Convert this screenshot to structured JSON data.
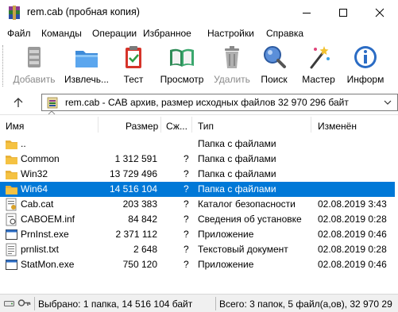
{
  "window": {
    "title": "rem.cab (пробная копия)"
  },
  "menu": [
    "Файл",
    "Команды",
    "Операции",
    "Избранное",
    "Настройки",
    "Справка"
  ],
  "toolbar": {
    "add": "Добавить",
    "extract": "Извлечь...",
    "test": "Тест",
    "view": "Просмотр",
    "delete": "Удалить",
    "find": "Поиск",
    "wizard": "Мастер",
    "info": "Информ"
  },
  "path": {
    "text": "rem.cab - CAB архив, размер исходных файлов 32 970 296 байт"
  },
  "columns": {
    "name": "Имя",
    "size": "Размер",
    "packed": "Сж...",
    "type": "Тип",
    "modified": "Изменён"
  },
  "rows": [
    {
      "name": "..",
      "size": "",
      "packed": "",
      "type": "Папка с файлами",
      "modified": "",
      "icon": "folder-up-icon"
    },
    {
      "name": "Common",
      "size": "1 312 591",
      "packed": "?",
      "type": "Папка с файлами",
      "modified": "",
      "icon": "folder-icon"
    },
    {
      "name": "Win32",
      "size": "13 729 496",
      "packed": "?",
      "type": "Папка с файлами",
      "modified": "",
      "icon": "folder-icon"
    },
    {
      "name": "Win64",
      "size": "14 516 104",
      "packed": "?",
      "type": "Папка с файлами",
      "modified": "",
      "icon": "folder-icon"
    },
    {
      "name": "Cab.cat",
      "size": "203 383",
      "packed": "?",
      "type": "Каталог безопасности",
      "modified": "02.08.2019 3:43",
      "icon": "catalog-icon"
    },
    {
      "name": "CABOEM.inf",
      "size": "84 842",
      "packed": "?",
      "type": "Сведения об установке",
      "modified": "02.08.2019 0:28",
      "icon": "inf-file-icon"
    },
    {
      "name": "PrnInst.exe",
      "size": "2 371 112",
      "packed": "?",
      "type": "Приложение",
      "modified": "02.08.2019 0:46",
      "icon": "exe-icon"
    },
    {
      "name": "prnlist.txt",
      "size": "2 648",
      "packed": "?",
      "type": "Текстовый документ",
      "modified": "02.08.2019 0:28",
      "icon": "text-file-icon"
    },
    {
      "name": "StatMon.exe",
      "size": "750 120",
      "packed": "?",
      "type": "Приложение",
      "modified": "02.08.2019 0:46",
      "icon": "exe-icon"
    }
  ],
  "selected_row_index": 3,
  "status": {
    "left": "Выбрано: 1 папка, 14 516 104 байт",
    "right": "Всего: 3 папок, 5 файл(а,ов), 32 970 29"
  },
  "colors": {
    "selection": "#0078d7",
    "folder": "#f5c242",
    "accent": "#0078d7"
  }
}
